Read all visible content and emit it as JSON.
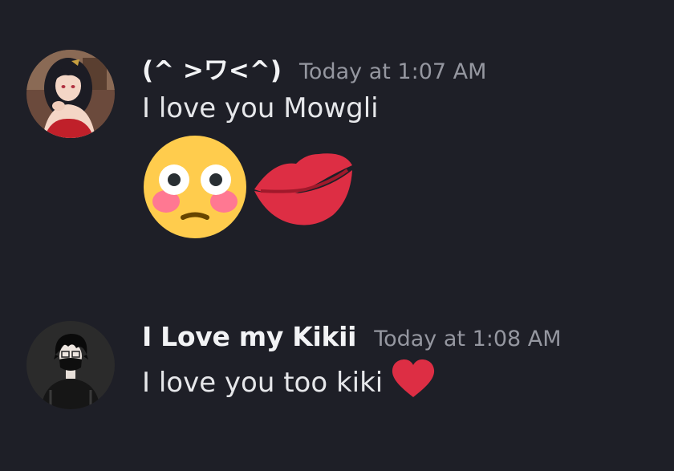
{
  "messages": [
    {
      "username": "(^ >ワ<^)",
      "timestamp": "Today at 1:07 AM",
      "text": "I love you Mowgli",
      "emojis": [
        "flushed-face-emoji",
        "kiss-mark-emoji"
      ],
      "avatar": "anime-girl-avatar"
    },
    {
      "username": "I Love my Kikii",
      "timestamp": "Today at 1:08 AM",
      "text": "I love you too kiki",
      "emojis": [
        "red-heart-emoji"
      ],
      "avatar": "masked-boy-avatar"
    }
  ],
  "colors": {
    "background": "#1e1f27",
    "username": "#f2f3f5",
    "timestamp": "#9597a0",
    "text": "#e6e7ea",
    "heart": "#dd2e44"
  }
}
